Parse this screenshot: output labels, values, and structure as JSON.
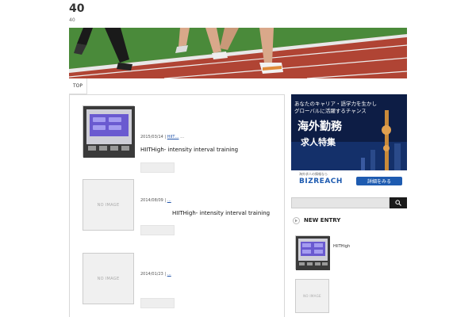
{
  "site": {
    "title": "40",
    "description": "40"
  },
  "nav": {
    "items": [
      {
        "label": "TOP"
      }
    ]
  },
  "entries": [
    {
      "date": "2015/03/14",
      "category": "HIIT…",
      "extra": "…",
      "title": "HIITHigh- intensity interval training",
      "has_image": true
    },
    {
      "date": "2014/08/09",
      "category": "",
      "extra": "…",
      "title": "HIITHigh- intensity interval training",
      "has_image": false
    },
    {
      "date": "2014/01/23",
      "category": "",
      "extra": "…",
      "title": "",
      "has_image": false
    }
  ],
  "no_image_label": "NO IMAGE",
  "ad": {
    "line1": "あなたのキャリア・語学力を生かし",
    "line2": "グローバルに活躍するチャンス",
    "headline1": "海外勤務",
    "headline2": "求人特集",
    "small_text": "海外求人の情報なら",
    "brand": "BIZREACH",
    "cta": "詳細をみる"
  },
  "search": {
    "value": ""
  },
  "sidebar": {
    "new_entry_title": "NEW ENTRY",
    "entries": [
      {
        "title": "HIITHigh",
        "has_image": true
      },
      {
        "title": "",
        "has_image": false
      }
    ]
  },
  "colors": {
    "track": "#b04434",
    "grass": "#4a8a3a",
    "ad_bg": "#0d1d45",
    "ad_brand": "#1e5bb0",
    "link": "#2255aa"
  }
}
